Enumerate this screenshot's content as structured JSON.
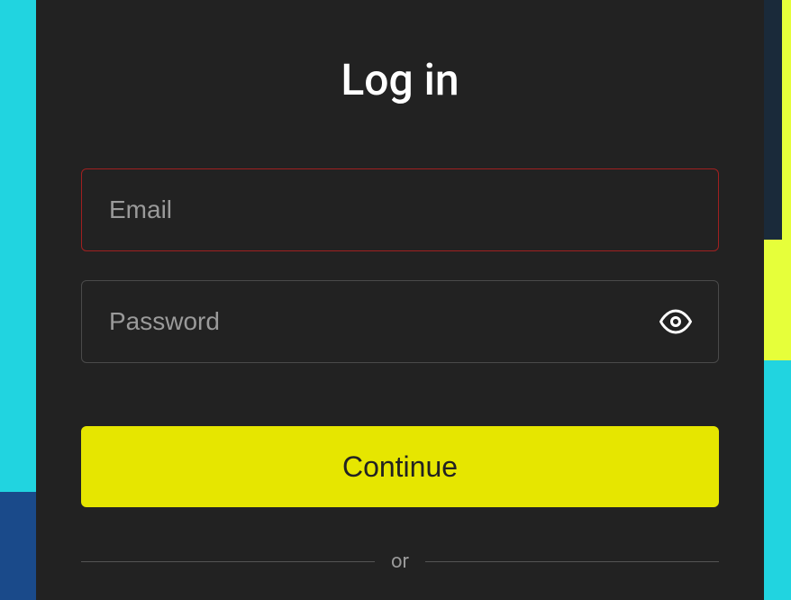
{
  "title": "Log in",
  "form": {
    "email": {
      "placeholder": "Email",
      "value": ""
    },
    "password": {
      "placeholder": "Password",
      "value": ""
    },
    "continue_label": "Continue"
  },
  "divider": {
    "text": "or"
  },
  "colors": {
    "panel_bg": "#222222",
    "accent_yellow": "#e6e600",
    "error_border": "#a02020",
    "bg_cyan": "#21d4e0"
  }
}
